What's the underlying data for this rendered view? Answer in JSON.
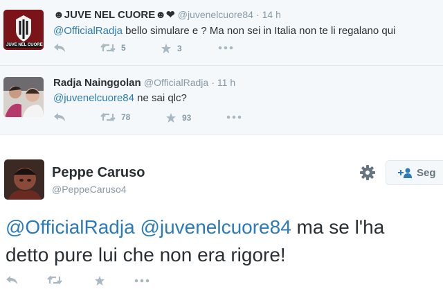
{
  "tweets": [
    {
      "name": "☻JUVE NEL CUORE☻❤",
      "handle": "@juvenelcuore84",
      "time": "· 14 h",
      "mention": "@OfficialRadja",
      "body": " bello simulare e ? Ma non sei in Italia non te li regalano qui",
      "retweets": "5",
      "favorites": "3",
      "avatar_text": "JUVE NEL CUORE"
    },
    {
      "name": "Radja Nainggolan",
      "handle": "@OfficialRadja",
      "time": "· 11 h",
      "mention": "@juvenelcuore84",
      "body": " ne sai qlc?",
      "retweets": "78",
      "favorites": "93"
    }
  ],
  "main_tweet": {
    "name": "Peppe Caruso",
    "handle": "@PeppeCaruso4",
    "mention1": "@OfficialRadja",
    "mention2": "@juvenelcuore84",
    "line1_rest": " ma se l'ha",
    "line2": "detto pure lui che non era rigore!",
    "follow_label": "Seg"
  },
  "colors": {
    "link": "#2b7bb9",
    "muted": "#8899a6",
    "icon": "#aab8c2",
    "bg_context": "#f5f8fa"
  }
}
